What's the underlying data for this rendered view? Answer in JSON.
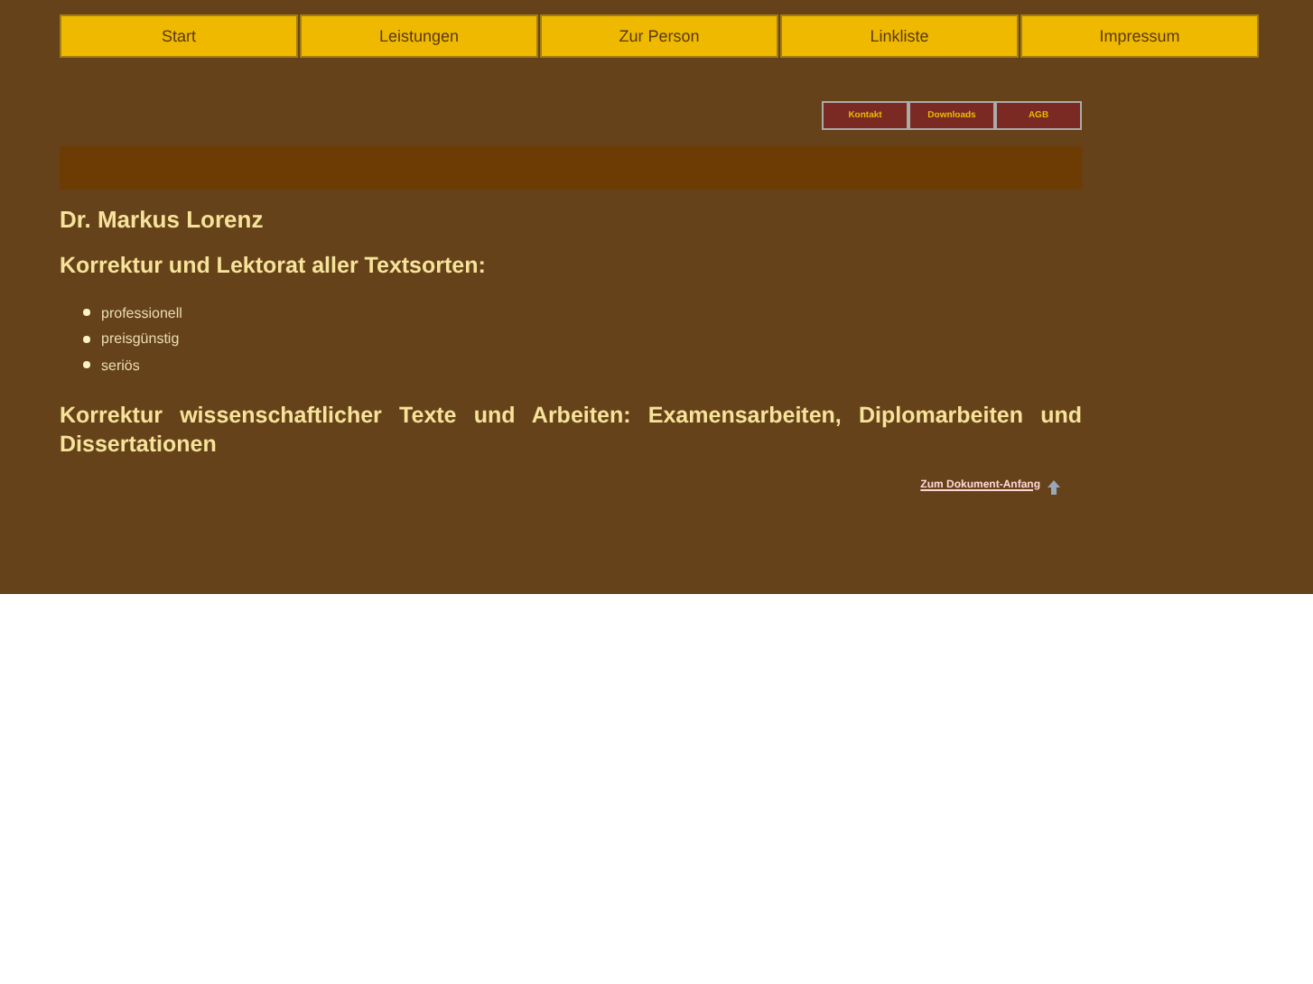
{
  "nav": [
    {
      "label": "Start"
    },
    {
      "label": "Leistungen"
    },
    {
      "label": "Zur Person"
    },
    {
      "label": "Linkliste"
    },
    {
      "label": "Impressum"
    }
  ],
  "subnav": [
    {
      "label": "Kontakt"
    },
    {
      "label": "Downloads"
    },
    {
      "label": "AGB"
    }
  ],
  "heading": "Dr. Markus Lorenz",
  "subheading": "Korrektur und Lektorat aller Textsorten:",
  "features": [
    "professionell",
    "preisgünstig",
    "seriös"
  ],
  "statement": "Korrektur wissenschaftlicher Texte und Arbeiten: Examensarbeiten, Diplomarbeiten und Dissertationen",
  "top_link": "Zum Dokument-Anfang"
}
